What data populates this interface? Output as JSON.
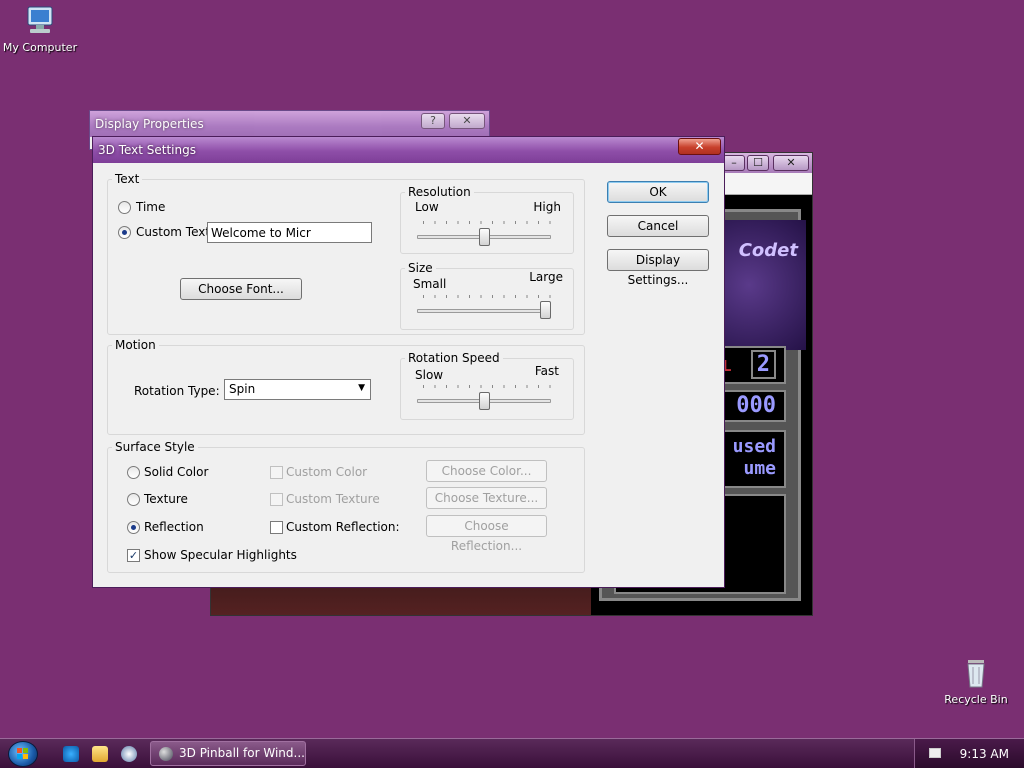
{
  "desktop": {
    "icons": [
      {
        "label": "My Computer",
        "icon": "computer-icon"
      },
      {
        "label": "Recycle Bin",
        "icon": "recycle-bin-icon"
      }
    ]
  },
  "display_properties": {
    "title": "Display Properties",
    "help": "?",
    "close": "✕"
  },
  "pinball_window": {
    "minimize": "–",
    "maximize": "☐",
    "close": "✕",
    "lines": [
      "2",
      "000",
      "used",
      "ume"
    ],
    "art_text": "Codet",
    "ball_label": "ALL"
  },
  "dialog": {
    "title": "3D Text Settings",
    "close": "✕",
    "buttons": {
      "ok": "OK",
      "cancel": "Cancel",
      "display_settings": "Display Settings..."
    },
    "text_group": {
      "label": "Text",
      "time_label": "Time",
      "custom_text_label": "Custom Text:",
      "custom_text_value": "Welcome to Micr",
      "choose_font": "Choose Font...",
      "selected": "custom_text"
    },
    "resolution": {
      "label": "Resolution",
      "low": "Low",
      "high": "High",
      "level": 0.5
    },
    "size": {
      "label": "Size",
      "small": "Small",
      "large": "Large",
      "level": 1.0
    },
    "motion_group": {
      "label": "Motion",
      "rotation_type_label": "Rotation Type:",
      "rotation_type_value": "Spin"
    },
    "rotation_speed": {
      "label": "Rotation Speed",
      "slow": "Slow",
      "fast": "Fast",
      "level": 0.5
    },
    "surface_group": {
      "label": "Surface Style",
      "solid_color": "Solid Color",
      "texture": "Texture",
      "reflection": "Reflection",
      "selected": "reflection",
      "custom_color": "Custom Color",
      "custom_texture": "Custom Texture",
      "custom_reflection": "Custom Reflection:",
      "choose_color": "Choose Color...",
      "choose_texture": "Choose Texture...",
      "choose_reflection": "Choose Reflection...",
      "show_specular": "Show Specular Highlights",
      "show_specular_checked": true,
      "custom_reflection_checked": false
    }
  },
  "taskbar": {
    "task_label": "3D Pinball for Wind...",
    "clock": "9:13 AM"
  },
  "colors": {
    "desktop": "#7a2f72",
    "title_accent": "#8e4ea8"
  }
}
